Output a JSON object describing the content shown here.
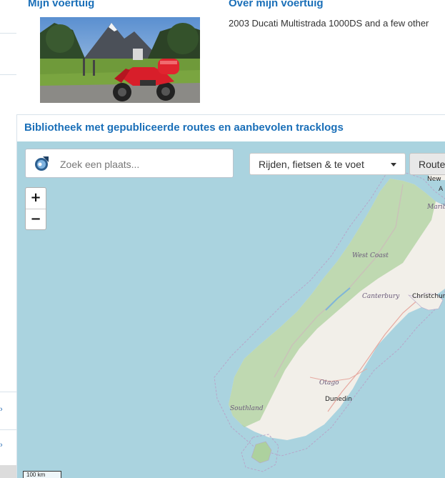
{
  "profile": {
    "vehicle_title": "Mijn voertuig",
    "about_title": "Over mijn voertuig",
    "about_text": "2003 Ducati Multistrada 1000DS and a few other"
  },
  "library": {
    "title": "Bibliotheek met gepubliceerde routes en aanbevolen tracklogs"
  },
  "map": {
    "search_placeholder": "Zoek een plaats...",
    "mode_selected": "Rijden, fietsen & te voet",
    "route_button": "Route",
    "zoom_in": "+",
    "zoom_out": "−",
    "scale": "100 km",
    "labels": {
      "new": "New",
      "a": "A",
      "maribo": "Maribo",
      "west_coast": "West Coast",
      "canterbury": "Canterbury",
      "christchurch": "Christchur",
      "otago": "Otago",
      "dunedin": "Dunedin",
      "southland": "Southland"
    }
  },
  "colors": {
    "heading_blue": "#1a6fb8",
    "water": "#aad3df",
    "land": "#f2efe9",
    "forest": "#add19e",
    "region_border": "#b7a6c9"
  },
  "icons": {
    "search": "location-pin-icon",
    "dropdown": "caret-down-icon"
  }
}
